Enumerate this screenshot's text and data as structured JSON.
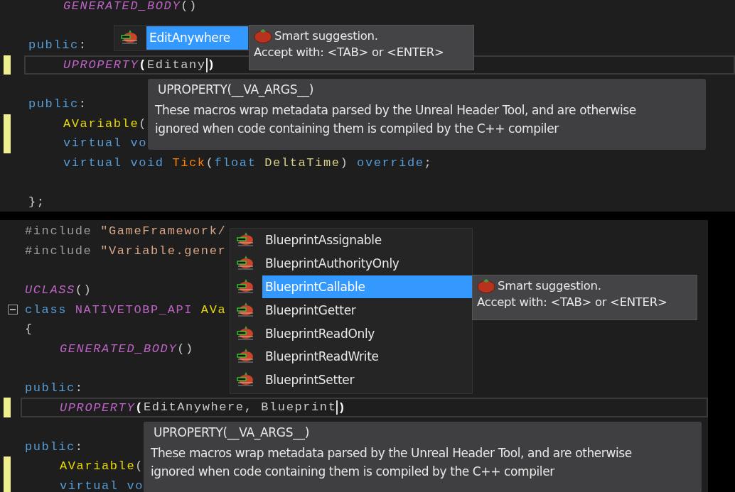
{
  "panels": [
    {
      "lines": [
        {
          "kind": "code",
          "indented": true,
          "changed": false,
          "current": false,
          "tokens": [
            {
              "kind": "macro",
              "text": "GENERATED_BODY"
            },
            {
              "kind": "plain",
              "text": "()"
            }
          ]
        },
        {
          "kind": "blank"
        },
        {
          "kind": "code",
          "indented": false,
          "changed": false,
          "current": false,
          "tokens": [
            {
              "kind": "keyword",
              "text": "public"
            },
            {
              "kind": "plain",
              "text": ":"
            }
          ]
        },
        {
          "kind": "code",
          "indented": true,
          "changed": true,
          "current": true,
          "tokens": [
            {
              "kind": "macro",
              "text": "UPROPERTY"
            },
            {
              "kind": "paren",
              "text": "("
            },
            {
              "kind": "plain",
              "text": "Editany",
              "caret": true
            },
            {
              "kind": "paren",
              "text": ")"
            }
          ]
        },
        {
          "kind": "blank"
        },
        {
          "kind": "code",
          "indented": false,
          "changed": false,
          "current": false,
          "tokens": [
            {
              "kind": "keyword",
              "text": "public"
            },
            {
              "kind": "plain",
              "text": ":"
            }
          ]
        },
        {
          "kind": "code",
          "indented": true,
          "changed": true,
          "current": false,
          "tokens": [
            {
              "kind": "type",
              "text": "AVariable"
            },
            {
              "kind": "plain",
              "text": "("
            }
          ]
        },
        {
          "kind": "code",
          "indented": true,
          "changed": true,
          "current": false,
          "tokens": [
            {
              "kind": "keyword",
              "text": "virtual vo"
            }
          ]
        },
        {
          "kind": "code",
          "indented": true,
          "changed": false,
          "current": false,
          "tokens": [
            {
              "kind": "keyword",
              "text": "virtual void "
            },
            {
              "kind": "func",
              "text": "Tick"
            },
            {
              "kind": "plain",
              "text": "("
            },
            {
              "kind": "keyword",
              "text": "float "
            },
            {
              "kind": "param",
              "text": "DeltaTime"
            },
            {
              "kind": "plain",
              "text": ") "
            },
            {
              "kind": "keyword",
              "text": "override"
            },
            {
              "kind": "plain",
              "text": ";"
            }
          ]
        },
        {
          "kind": "blank"
        },
        {
          "kind": "code",
          "indented": false,
          "changed": false,
          "current": false,
          "tokens": [
            {
              "kind": "plain",
              "text": "};"
            }
          ]
        }
      ],
      "completion": {
        "items": [
          {
            "label": "EditAnywhere",
            "selected": true
          }
        ]
      },
      "smart_tip": {
        "title": "Smart suggestion.",
        "hint": "Accept with: <TAB> or <ENTER>"
      },
      "quick_info": {
        "signature": "UPROPERTY(__VA_ARGS__)",
        "lines": [
          "These macros wrap metadata parsed by the Unreal Header Tool, and are otherwise",
          "ignored when code containing them is compiled by the C++ compiler"
        ]
      }
    },
    {
      "lines": [
        {
          "kind": "code",
          "indented": false,
          "changed": false,
          "current": false,
          "tokens": [
            {
              "kind": "preproc",
              "text": "#include "
            },
            {
              "kind": "string",
              "text": "\"GameFramework/"
            }
          ]
        },
        {
          "kind": "code",
          "indented": false,
          "changed": false,
          "current": false,
          "tokens": [
            {
              "kind": "preproc",
              "text": "#include "
            },
            {
              "kind": "string",
              "text": "\"Variable.gener"
            }
          ]
        },
        {
          "kind": "blank"
        },
        {
          "kind": "code",
          "indented": false,
          "changed": false,
          "current": false,
          "tokens": [
            {
              "kind": "macro",
              "text": "UCLASS"
            },
            {
              "kind": "plain",
              "text": "()"
            }
          ]
        },
        {
          "kind": "code",
          "indented": false,
          "changed": false,
          "current": false,
          "expanded": true,
          "tokens": [
            {
              "kind": "keyword",
              "text": "class "
            },
            {
              "kind": "api",
              "text": "NATIVETOBP_API "
            },
            {
              "kind": "type",
              "text": "AVa"
            }
          ]
        },
        {
          "kind": "code",
          "indented": false,
          "changed": false,
          "current": false,
          "tokens": [
            {
              "kind": "plain",
              "text": "{"
            }
          ]
        },
        {
          "kind": "code",
          "indented": true,
          "changed": false,
          "current": false,
          "tokens": [
            {
              "kind": "macro",
              "text": "GENERATED_BODY"
            },
            {
              "kind": "plain",
              "text": "()"
            }
          ]
        },
        {
          "kind": "blank"
        },
        {
          "kind": "code",
          "indented": false,
          "changed": false,
          "current": false,
          "tokens": [
            {
              "kind": "keyword",
              "text": "public"
            },
            {
              "kind": "plain",
              "text": ":"
            }
          ]
        },
        {
          "kind": "code",
          "indented": true,
          "changed": true,
          "current": true,
          "tokens": [
            {
              "kind": "macro",
              "text": "UPROPERTY"
            },
            {
              "kind": "paren",
              "text": "("
            },
            {
              "kind": "plain",
              "text": "EditAnywhere, Blueprint",
              "caret": true
            },
            {
              "kind": "paren",
              "text": ")"
            }
          ]
        },
        {
          "kind": "blank"
        },
        {
          "kind": "code",
          "indented": false,
          "changed": false,
          "current": false,
          "tokens": [
            {
              "kind": "keyword",
              "text": "public"
            },
            {
              "kind": "plain",
              "text": ":"
            }
          ]
        },
        {
          "kind": "code",
          "indented": true,
          "changed": true,
          "current": false,
          "tokens": [
            {
              "kind": "type",
              "text": "AVariable"
            },
            {
              "kind": "plain",
              "text": "("
            }
          ]
        },
        {
          "kind": "code",
          "indented": true,
          "changed": true,
          "current": false,
          "tokens": [
            {
              "kind": "keyword",
              "text": "virtual vo"
            }
          ]
        }
      ],
      "completion": {
        "items": [
          {
            "label": "BlueprintAssignable",
            "selected": false
          },
          {
            "label": "BlueprintAuthorityOnly",
            "selected": false
          },
          {
            "label": "BlueprintCallable",
            "selected": true
          },
          {
            "label": "BlueprintGetter",
            "selected": false
          },
          {
            "label": "BlueprintReadOnly",
            "selected": false
          },
          {
            "label": "BlueprintReadWrite",
            "selected": false
          },
          {
            "label": "BlueprintSetter",
            "selected": false
          }
        ]
      },
      "smart_tip": {
        "title": "Smart suggestion.",
        "hint": "Accept with: <TAB> or <ENTER>"
      },
      "quick_info": {
        "signature": "UPROPERTY(__VA_ARGS__)",
        "lines": [
          "These macros wrap metadata parsed by the Unreal Header Tool, and are otherwise",
          "ignored when code containing them is compiled by the C++ compiler"
        ]
      }
    }
  ]
}
